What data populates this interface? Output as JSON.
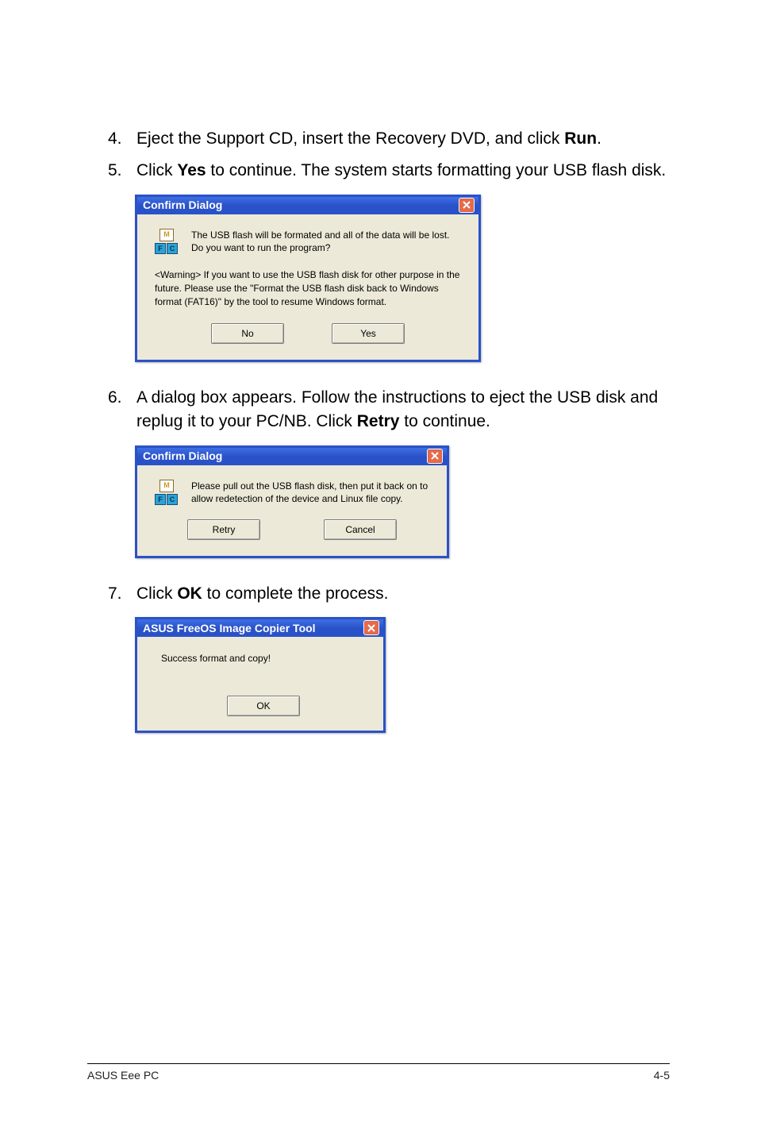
{
  "steps": {
    "s4": {
      "num": "4.",
      "pre": "Eject the Support CD, insert the Recovery DVD, and click ",
      "bold": "Run",
      "post": "."
    },
    "s5": {
      "num": "5.",
      "pre": "Click ",
      "bold": "Yes",
      "post": " to continue. The system starts formatting your USB flash disk."
    },
    "s6": {
      "num": "6.",
      "pre": "A dialog box appears. Follow the instructions to eject the USB disk and replug it to your PC/NB. Click ",
      "bold": "Retry",
      "post": " to continue."
    },
    "s7": {
      "num": "7.",
      "pre": "Click ",
      "bold": "OK",
      "post": " to complete the process."
    }
  },
  "dialog1": {
    "title": "Confirm Dialog",
    "message": "The USB flash will be formated and all of the data will be lost. Do you want to run the program?",
    "warning": "<Warning> If you want to use the USB flash disk for other purpose in the future. Please use the \"Format the USB flash disk back to Windows format (FAT16)\" by the tool to resume Windows format.",
    "btn_no": "No",
    "btn_yes": "Yes"
  },
  "dialog2": {
    "title": "Confirm Dialog",
    "message": "Please pull out the USB flash disk, then put it back on to allow redetection of the device and Linux file copy.",
    "btn_retry": "Retry",
    "btn_cancel": "Cancel"
  },
  "dialog3": {
    "title": "ASUS FreeOS Image Copier Tool",
    "message": "Success format and copy!",
    "btn_ok": "OK"
  },
  "footer": {
    "left": "ASUS Eee PC",
    "right": "4-5"
  }
}
